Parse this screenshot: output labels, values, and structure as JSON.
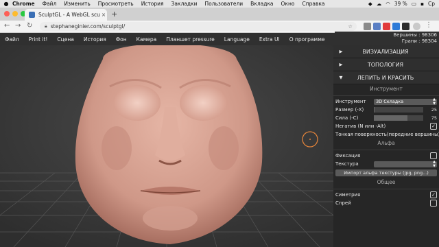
{
  "mac_menu": {
    "apple": "",
    "app": "Chrome",
    "items": [
      "Файл",
      "Изменить",
      "Просмотреть",
      "История",
      "Закладки",
      "Пользователи",
      "Вкладка",
      "Окно",
      "Справка"
    ],
    "battery": "39 %",
    "day": "Ср"
  },
  "browser": {
    "tab_title": "SculptGL - A WebGL sculpting",
    "new_tab": "+",
    "url": "stephaneginier.com/sculptgl/",
    "nav_back": "←",
    "nav_forward": "→",
    "nav_reload": "↻"
  },
  "app_menu": [
    "Файл",
    "Print it!",
    "Сцена",
    "История",
    "Фон",
    "Камера",
    "Планшет pressure",
    "Language",
    "Extra UI",
    "О программе"
  ],
  "stats": {
    "vertices": "Вершины : 98306",
    "faces": "Грани : 98304"
  },
  "panel": {
    "sections": {
      "visualization": {
        "arrow": "▶",
        "label": "ВИЗУАЛИЗАЦИЯ"
      },
      "topology": {
        "arrow": "▶",
        "label": "ТОПОЛОГИЯ"
      },
      "sculpt": {
        "arrow": "▼",
        "label": "ЛЕПИТЬ И КРАСИТЬ"
      }
    },
    "tool_header": "Инструмент",
    "tool_label": "Инструмент",
    "tool_value": "3D Складка",
    "size_label": "Размер (-X)",
    "size_value": "25",
    "size_fraction": 0.02,
    "strength_label": "Сила (-C)",
    "strength_value": "75",
    "strength_fraction": 0.68,
    "negative_label": "Негатив (N или -Alt)",
    "negative_checked": "✓",
    "thin_label": "Тонкая поверхность(передние вершины)",
    "alpha_header": "Альфа",
    "fix_label": "Фиксация",
    "texture_label": "Текстура",
    "import_button": "Импорт альфа текстуры (jpg, png...)",
    "common_header": "Общее",
    "symmetry_label": "Симетрия",
    "symmetry_checked": "✓",
    "spray_label": "Спрей"
  },
  "colors": {
    "accent_ring": "#e0823a",
    "skin": "#d8a292",
    "panel_bg": "#262626"
  }
}
